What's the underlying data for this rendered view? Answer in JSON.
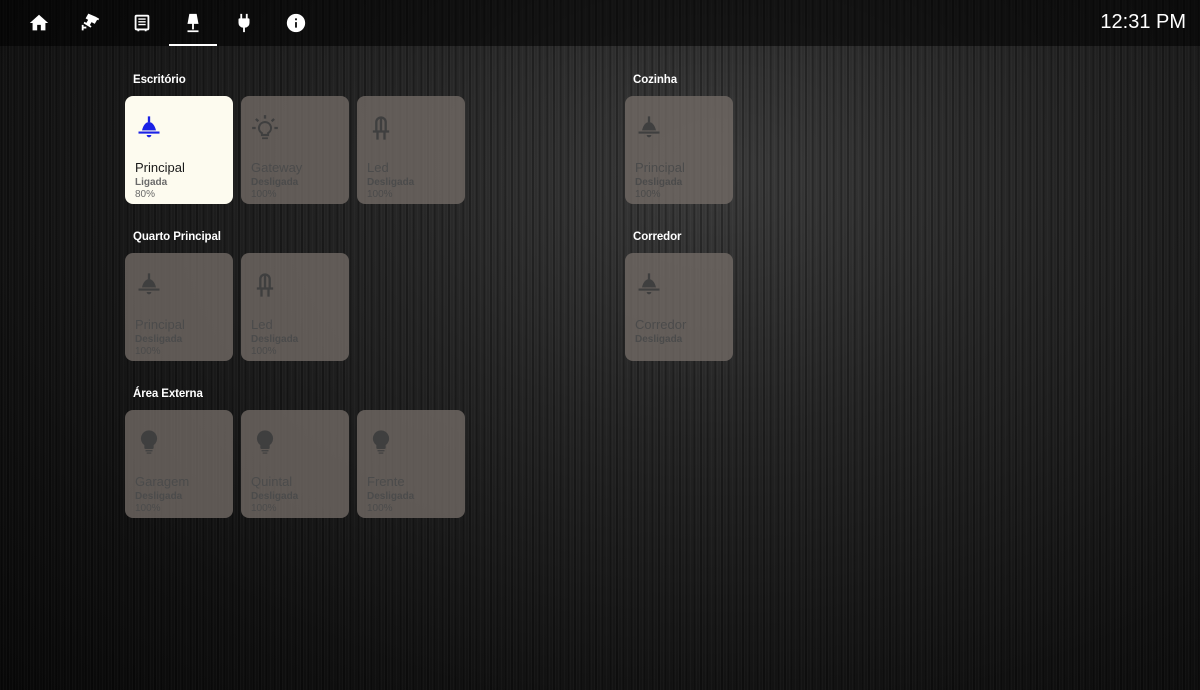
{
  "header": {
    "tabs": [
      {
        "icon": "home-icon",
        "active": false
      },
      {
        "icon": "cctv-camera-icon",
        "active": false
      },
      {
        "icon": "radiator-heater-icon",
        "active": false
      },
      {
        "icon": "floor-lamp-icon",
        "active": true
      },
      {
        "icon": "power-plug-icon",
        "active": false
      },
      {
        "icon": "info-icon",
        "active": false
      }
    ],
    "time": "12:31 PM"
  },
  "groups": {
    "escritorio": {
      "title": "Escritório",
      "tiles": [
        {
          "name": "Principal",
          "state": "Ligada",
          "level": "80%",
          "on": true,
          "icon": "ceiling-light-icon"
        },
        {
          "name": "Gateway",
          "state": "Desligada",
          "level": "100%",
          "on": false,
          "icon": "lightbulb-rays-icon"
        },
        {
          "name": "Led",
          "state": "Desligada",
          "level": "100%",
          "on": false,
          "icon": "led-icon"
        }
      ]
    },
    "cozinha": {
      "title": "Cozinha",
      "tiles": [
        {
          "name": "Principal",
          "state": "Desligada",
          "level": "100%",
          "on": false,
          "icon": "ceiling-light-icon"
        }
      ]
    },
    "quarto": {
      "title": "Quarto Principal",
      "tiles": [
        {
          "name": "Principal",
          "state": "Desligada",
          "level": "100%",
          "on": false,
          "icon": "ceiling-light-icon"
        },
        {
          "name": "Led",
          "state": "Desligada",
          "level": "100%",
          "on": false,
          "icon": "led-icon"
        }
      ]
    },
    "corredor": {
      "title": "Corredor",
      "tiles": [
        {
          "name": "Corredor",
          "state": "Desligada",
          "on": false,
          "icon": "ceiling-light-icon"
        }
      ]
    },
    "externa": {
      "title": "Área Externa",
      "tiles": [
        {
          "name": "Garagem",
          "state": "Desligada",
          "level": "100%",
          "on": false,
          "icon": "lightbulb-icon"
        },
        {
          "name": "Quintal",
          "state": "Desligada",
          "level": "100%",
          "on": false,
          "icon": "lightbulb-icon"
        },
        {
          "name": "Frente",
          "state": "Desligada",
          "level": "100%",
          "on": false,
          "icon": "lightbulb-icon"
        }
      ]
    }
  },
  "colors": {
    "tile_off": "#736c66",
    "tile_on": "#fdfbef",
    "icon_on": "#1b22e6",
    "icon_off": "#3f3f3f"
  }
}
